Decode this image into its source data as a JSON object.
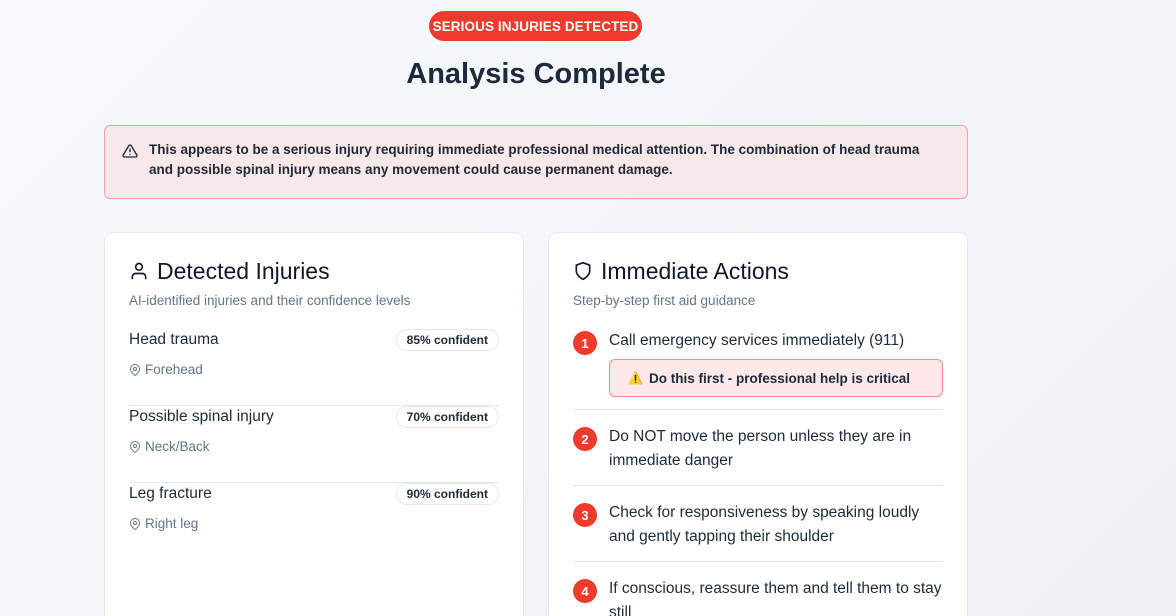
{
  "badge": "SERIOUS INJURIES DETECTED",
  "title": "Analysis Complete",
  "alert": {
    "icon": "warning-triangle-icon",
    "text": "This appears to be a serious injury requiring immediate professional medical attention. The combination of head trauma and possible spinal injury means any movement could cause permanent damage."
  },
  "injuries_card": {
    "icon": "user-icon",
    "title": "Detected Injuries",
    "subtitle": "AI-identified injuries and their confidence levels",
    "items": [
      {
        "name": "Head trauma",
        "confidence": "85% confident",
        "location": "Forehead"
      },
      {
        "name": "Possible spinal injury",
        "confidence": "70% confident",
        "location": "Neck/Back"
      },
      {
        "name": "Leg fracture",
        "confidence": "90% confident",
        "location": "Right leg"
      }
    ]
  },
  "actions_card": {
    "icon": "shield-icon",
    "title": "Immediate Actions",
    "subtitle": "Step-by-step first aid guidance",
    "steps": [
      {
        "num": "1",
        "text": "Call emergency services immediately (911)",
        "note": "Do this first - professional help is critical"
      },
      {
        "num": "2",
        "text": "Do NOT move the person unless they are in immediate danger"
      },
      {
        "num": "3",
        "text": "Check for responsiveness by speaking loudly and gently tapping their shoulder"
      },
      {
        "num": "4",
        "text": "If conscious, reassure them and tell them to stay still"
      }
    ]
  },
  "colors": {
    "accent": "#ef3b2d",
    "alert_bg": "#f9e8ea",
    "alert_border": "#f5a3a3"
  }
}
